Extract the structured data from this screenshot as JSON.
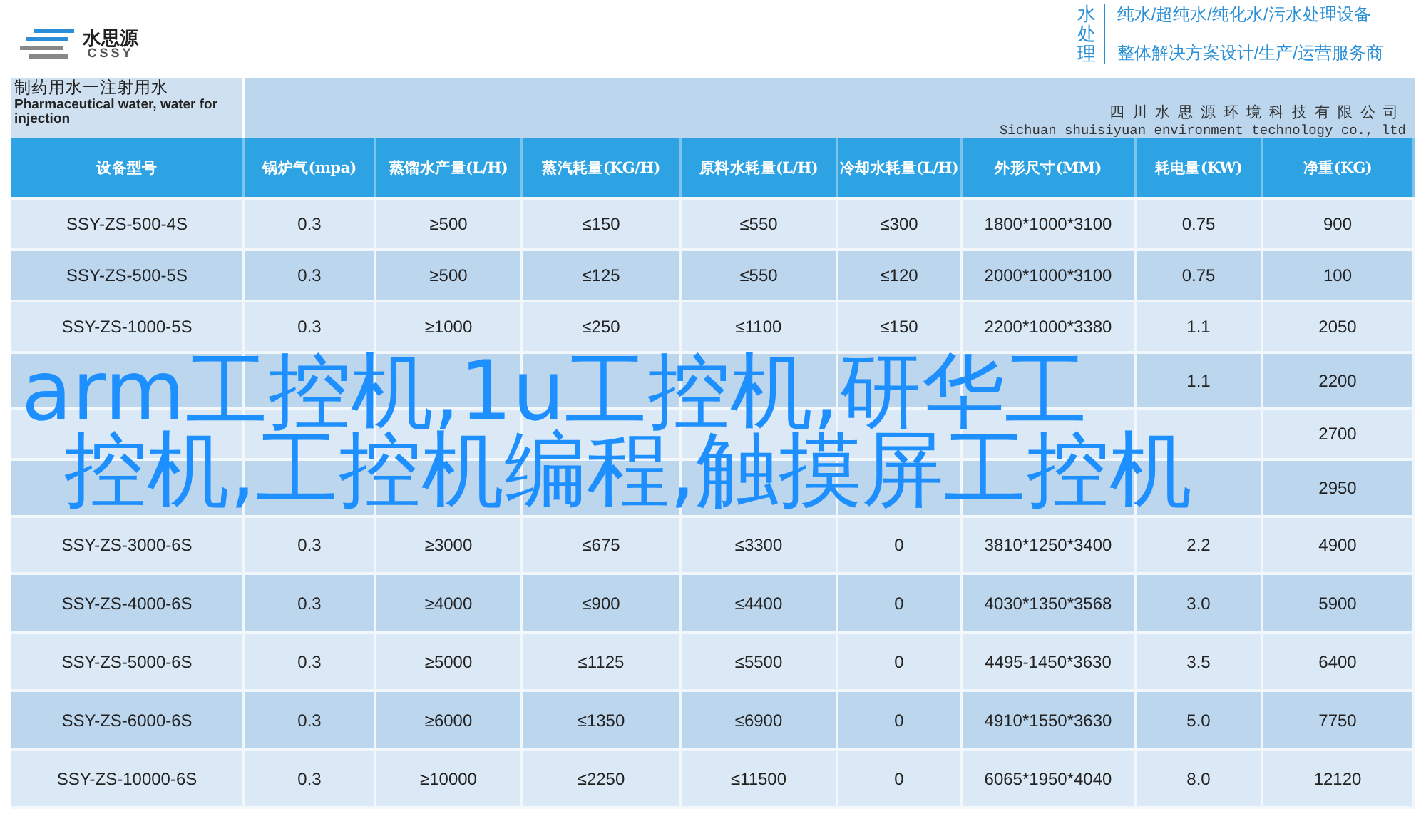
{
  "brand": {
    "name": "水思源",
    "latin": "CSSY"
  },
  "service": {
    "label": "水处理",
    "lines": [
      "纯水/超纯水/纯化水/污水处理设备",
      "整体解决方案设计/生产/运营服务商"
    ]
  },
  "banner": {
    "title": "制药用水一注射用水",
    "subtitle": "Pharmaceutical water, water for injection",
    "company": "四川水思源环境科技有限公司",
    "company_en": "Sichuan shuisiyuan environment technology co., ltd"
  },
  "table": {
    "columns": [
      "设备型号",
      "锅炉气(mpa)",
      "蒸馏水产量(L/H)",
      "蒸汽耗量(KG/H)",
      "原料水耗量(L/H)",
      "冷却水耗量(L/H)",
      "外形尺寸(MM)",
      "耗电量(KW)",
      "净重(KG)"
    ],
    "rows": [
      [
        "SSY-ZS-500-4S",
        "0.3",
        "≥500",
        "≤150",
        "≤550",
        "≤300",
        "1800*1000*3100",
        "0.75",
        "900"
      ],
      [
        "SSY-ZS-500-5S",
        "0.3",
        "≥500",
        "≤125",
        "≤550",
        "≤120",
        "2000*1000*3100",
        "0.75",
        "100"
      ],
      [
        "SSY-ZS-1000-5S",
        "0.3",
        "≥1000",
        "≤250",
        "≤1100",
        "≤150",
        "2200*1000*3380",
        "1.1",
        "2050"
      ],
      [
        null,
        null,
        null,
        null,
        null,
        null,
        null,
        "1.1",
        "2200"
      ],
      [
        null,
        null,
        null,
        null,
        null,
        null,
        null,
        null,
        "2700"
      ],
      [
        null,
        null,
        null,
        null,
        null,
        null,
        null,
        null,
        "2950"
      ],
      [
        "SSY-ZS-3000-6S",
        "0.3",
        "≥3000",
        "≤675",
        "≤3300",
        "0",
        "3810*1250*3400",
        "2.2",
        "4900"
      ],
      [
        "SSY-ZS-4000-6S",
        "0.3",
        "≥4000",
        "≤900",
        "≤4400",
        "0",
        "4030*1350*3568",
        "3.0",
        "5900"
      ],
      [
        "SSY-ZS-5000-6S",
        "0.3",
        "≥5000",
        "≤1125",
        "≤5500",
        "0",
        "4495-1450*3630",
        "3.5",
        "6400"
      ],
      [
        "SSY-ZS-6000-6S",
        "0.3",
        "≥6000",
        "≤1350",
        "≤6900",
        "0",
        "4910*1550*3630",
        "5.0",
        "7750"
      ],
      [
        "SSY-ZS-10000-6S",
        "0.3",
        "≥10000",
        "≤2250",
        "≤11500",
        "0",
        "6065*1950*4040",
        "8.0",
        "12120"
      ]
    ]
  },
  "overlay_lines": [
    "arm工控机,1u工控机,研华工",
    "控机,工控机编程,触摸屏工控机"
  ]
}
